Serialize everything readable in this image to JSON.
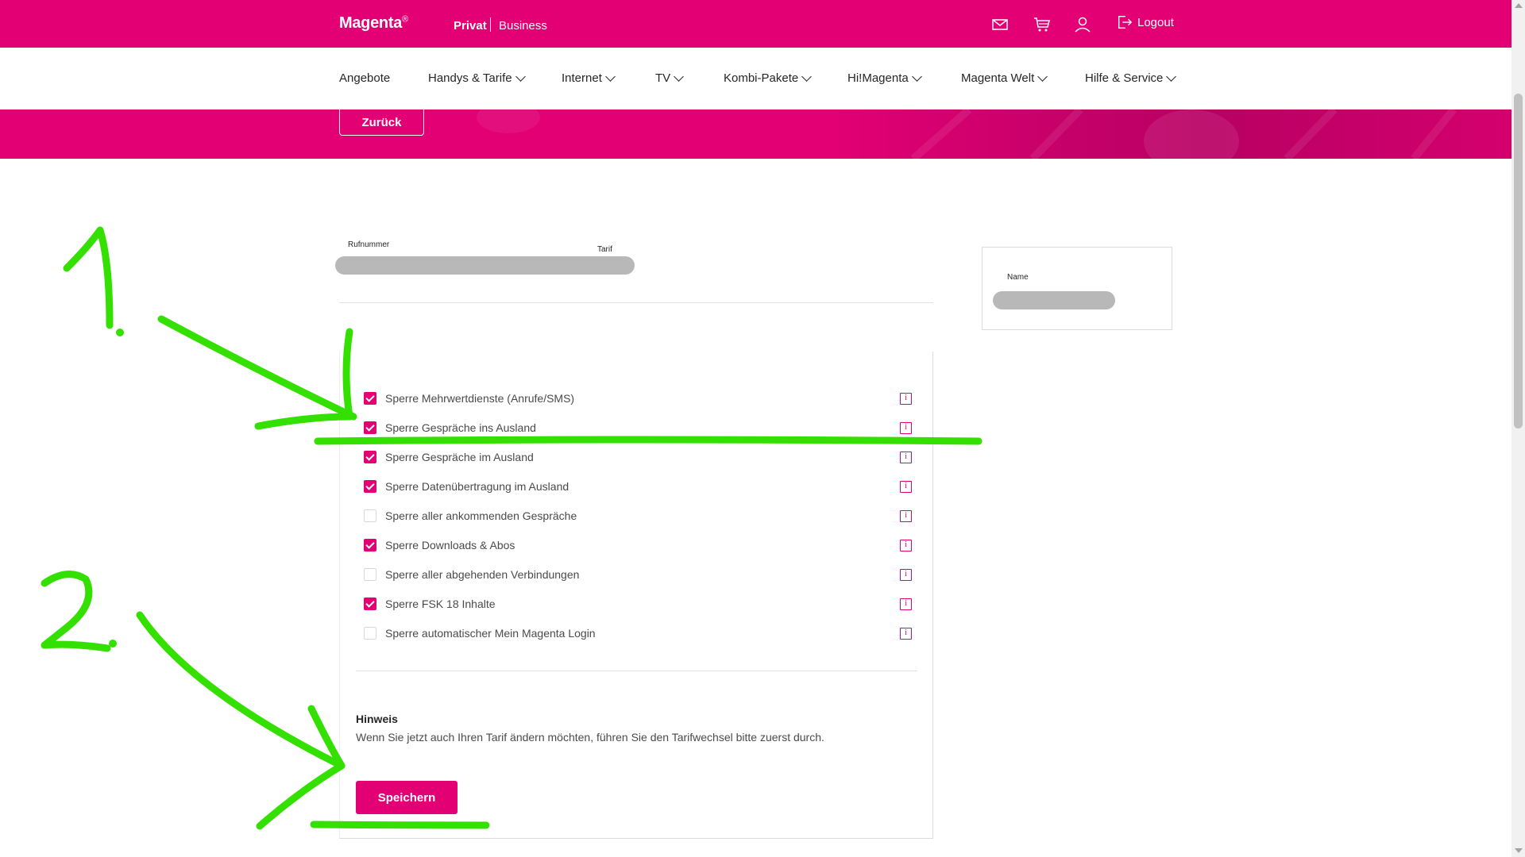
{
  "header": {
    "brand": "Magenta",
    "brand_mark": "®",
    "segment_privat": "Privat",
    "segment_business": "Business",
    "logout_label": "Logout",
    "icons": [
      "mail-icon",
      "cart-icon",
      "user-icon",
      "logout-icon"
    ]
  },
  "nav": {
    "items": [
      {
        "label": "Angebote",
        "dropdown": false
      },
      {
        "label": "Handys & Tarife",
        "dropdown": true
      },
      {
        "label": "Internet",
        "dropdown": true
      },
      {
        "label": "TV",
        "dropdown": true
      },
      {
        "label": "Kombi-Pakete",
        "dropdown": true
      },
      {
        "label": "Hi!Magenta",
        "dropdown": true
      },
      {
        "label": "Magenta Welt",
        "dropdown": true
      },
      {
        "label": "Hilfe & Service",
        "dropdown": true
      }
    ]
  },
  "hero": {
    "back_label": "Zurück"
  },
  "account": {
    "rufnummer_label": "Rufnummer",
    "tarif_label": "Tarif",
    "name_label": "Name"
  },
  "options": [
    {
      "label": "Sperre Mehrwertdienste (Anrufe/SMS)",
      "checked": true
    },
    {
      "label": "Sperre Gespräche ins Ausland",
      "checked": true
    },
    {
      "label": "Sperre Gespräche im Ausland",
      "checked": true
    },
    {
      "label": "Sperre Datenübertragung im Ausland",
      "checked": true
    },
    {
      "label": "Sperre aller ankommenden Gespräche",
      "checked": false
    },
    {
      "label": "Sperre Downloads & Abos",
      "checked": true
    },
    {
      "label": "Sperre aller abgehenden Verbindungen",
      "checked": false
    },
    {
      "label": "Sperre FSK 18 Inhalte",
      "checked": true
    },
    {
      "label": "Sperre automatischer Mein Magenta Login",
      "checked": false
    }
  ],
  "info_glyph": "i",
  "hinweis": {
    "title": "Hinweis",
    "text": "Wenn Sie jetzt auch Ihren Tarif ändern möchten, führen Sie den Tarifwechsel bitte zuerst durch."
  },
  "save_label": "Speichern",
  "colors": {
    "brand": "#e20074",
    "annotation": "#33e000"
  }
}
